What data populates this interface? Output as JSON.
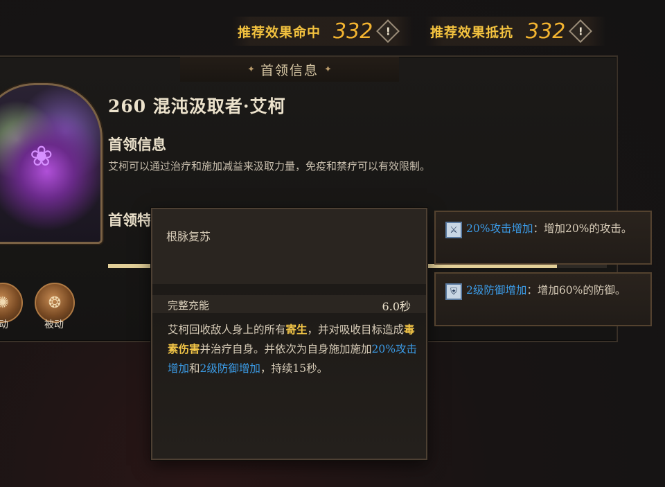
{
  "stats": [
    {
      "label": "推荐效果命中",
      "value": "332"
    },
    {
      "label": "推荐效果抵抗",
      "value": "332"
    }
  ],
  "panel": {
    "title": "首领信息",
    "boss_name": "260 混沌汲取者·艾柯",
    "info_heading": "首领信息",
    "info_desc": "艾柯可以通过治疗和施加减益来汲取力量，免疫和禁疗可以有效限制。",
    "feature_heading": "首领特",
    "progress_percent": 90
  },
  "skills": [
    {
      "label": "动",
      "icon": "skill-icon"
    },
    {
      "label": "被动",
      "icon": "skill-icon"
    }
  ],
  "tooltip": {
    "skill_name": "根脉复苏",
    "row_label": "完整充能",
    "row_value": "6.0秒",
    "desc_parts": {
      "p1": "艾柯回收敌人身上的所有",
      "k1": "寄生",
      "p2": "，并对吸收目标造成",
      "k2": "毒素伤害",
      "p3": "并治疗自身。并依次为自身施加施加",
      "k3": "20%攻击增加",
      "p4": "和",
      "k4": "2级防御增加",
      "p5": "，持续15秒。"
    }
  },
  "buffs": [
    {
      "name": "20%攻击增加",
      "desc": "：增加20%的攻击。",
      "icon": "sword-icon"
    },
    {
      "name": "2级防御增加",
      "desc": "：增加60%的防御。",
      "icon": "shield-icon"
    }
  ],
  "colors": {
    "gold": "#f2c547",
    "blue": "#3b9be6",
    "panel_border": "#3a3128"
  }
}
